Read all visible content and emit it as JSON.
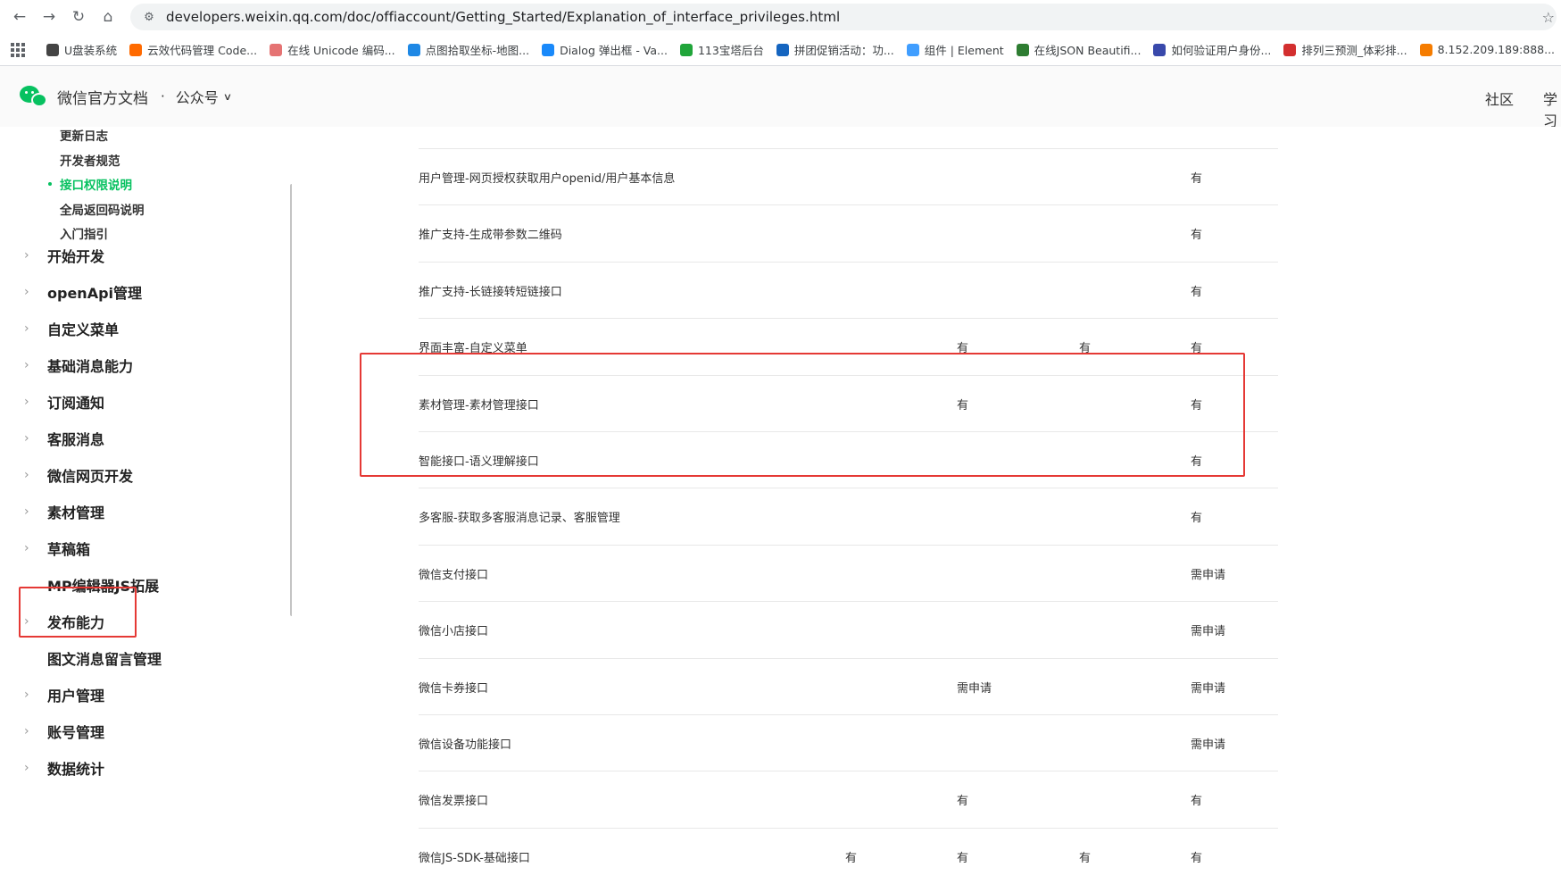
{
  "browser": {
    "url": "developers.weixin.qq.com/doc/offiaccount/Getting_Started/Explanation_of_interface_privileges.html",
    "bookmarks": [
      {
        "label": "U盘装系统",
        "icon": "globe-icon",
        "color": "#444444"
      },
      {
        "label": "云效代码管理 Code...",
        "icon": "code-icon",
        "color": "#ff6a00"
      },
      {
        "label": "在线 Unicode 编码...",
        "icon": "unicode-icon",
        "color": "#e57373"
      },
      {
        "label": "点图拾取坐标-地图...",
        "icon": "map-pin-icon",
        "color": "#1e88e5"
      },
      {
        "label": "Dialog 弹出框 - Va...",
        "icon": "vant-icon",
        "color": "#1989fa"
      },
      {
        "label": "113宝塔后台",
        "icon": "shield-icon",
        "color": "#20a53a"
      },
      {
        "label": "拼团促销活动：功...",
        "icon": "cart-icon",
        "color": "#1565c0"
      },
      {
        "label": "组件 | Element",
        "icon": "element-icon",
        "color": "#409eff"
      },
      {
        "label": "在线JSON Beautifi...",
        "icon": "json-icon",
        "color": "#2e7d32"
      },
      {
        "label": "如何验证用户身份...",
        "icon": "shield-check-icon",
        "color": "#3949ab"
      },
      {
        "label": "排列三预测_体彩排...",
        "icon": "lottery-icon",
        "color": "#d32f2f"
      },
      {
        "label": "8.152.209.189:888...",
        "icon": "server-icon",
        "color": "#f57c00"
      }
    ]
  },
  "header": {
    "site_title": "微信官方文档",
    "separator": "·",
    "section": "公众号",
    "links": [
      "社区",
      "学习"
    ]
  },
  "sidebar": {
    "sub_items": [
      {
        "label": "更新日志",
        "active": false
      },
      {
        "label": "开发者规范",
        "active": false
      },
      {
        "label": "接口权限说明",
        "active": true
      },
      {
        "label": "全局返回码说明",
        "active": false
      },
      {
        "label": "入门指引",
        "active": false
      }
    ],
    "items": [
      {
        "label": "开始开发",
        "arrow": true
      },
      {
        "label": "openApi管理",
        "arrow": true
      },
      {
        "label": "自定义菜单",
        "arrow": true
      },
      {
        "label": "基础消息能力",
        "arrow": true
      },
      {
        "label": "订阅通知",
        "arrow": true
      },
      {
        "label": "客服消息",
        "arrow": true
      },
      {
        "label": "微信网页开发",
        "arrow": true
      },
      {
        "label": "素材管理",
        "arrow": true
      },
      {
        "label": "草稿箱",
        "arrow": true
      },
      {
        "label": "MP编辑器JS拓展",
        "arrow": false
      },
      {
        "label": "发布能力",
        "arrow": true
      },
      {
        "label": "图文消息留言管理",
        "arrow": false
      },
      {
        "label": "用户管理",
        "arrow": true
      },
      {
        "label": "账号管理",
        "arrow": true
      },
      {
        "label": "数据统计",
        "arrow": true
      }
    ]
  },
  "table": {
    "rows": [
      {
        "name": "用户管理-网页授权获取用户openid/用户基本信息",
        "c1": "",
        "c2": "",
        "c3": "",
        "c4": "有"
      },
      {
        "name": "推广支持-生成带参数二维码",
        "c1": "",
        "c2": "",
        "c3": "",
        "c4": "有"
      },
      {
        "name": "推广支持-长链接转短链接口",
        "c1": "",
        "c2": "",
        "c3": "",
        "c4": "有"
      },
      {
        "name": "界面丰富-自定义菜单",
        "c1": "",
        "c2": "有",
        "c3": "有",
        "c4": "有"
      },
      {
        "name": "素材管理-素材管理接口",
        "c1": "",
        "c2": "有",
        "c3": "",
        "c4": "有"
      },
      {
        "name": "智能接口-语义理解接口",
        "c1": "",
        "c2": "",
        "c3": "",
        "c4": "有"
      },
      {
        "name": "多客服-获取多客服消息记录、客服管理",
        "c1": "",
        "c2": "",
        "c3": "",
        "c4": "有"
      },
      {
        "name": "微信支付接口",
        "c1": "",
        "c2": "",
        "c3": "",
        "c4": "需申请"
      },
      {
        "name": "微信小店接口",
        "c1": "",
        "c2": "",
        "c3": "",
        "c4": "需申请"
      },
      {
        "name": "微信卡券接口",
        "c1": "",
        "c2": "需申请",
        "c3": "",
        "c4": "需申请"
      },
      {
        "name": "微信设备功能接口",
        "c1": "",
        "c2": "",
        "c3": "",
        "c4": "需申请"
      },
      {
        "name": "微信发票接口",
        "c1": "",
        "c2": "有",
        "c3": "",
        "c4": "有"
      },
      {
        "name": "微信JS-SDK-基础接口",
        "c1": "有",
        "c2": "有",
        "c3": "有",
        "c4": "有"
      }
    ]
  },
  "colors": {
    "accent": "#07c160",
    "highlight": "#e53935"
  }
}
